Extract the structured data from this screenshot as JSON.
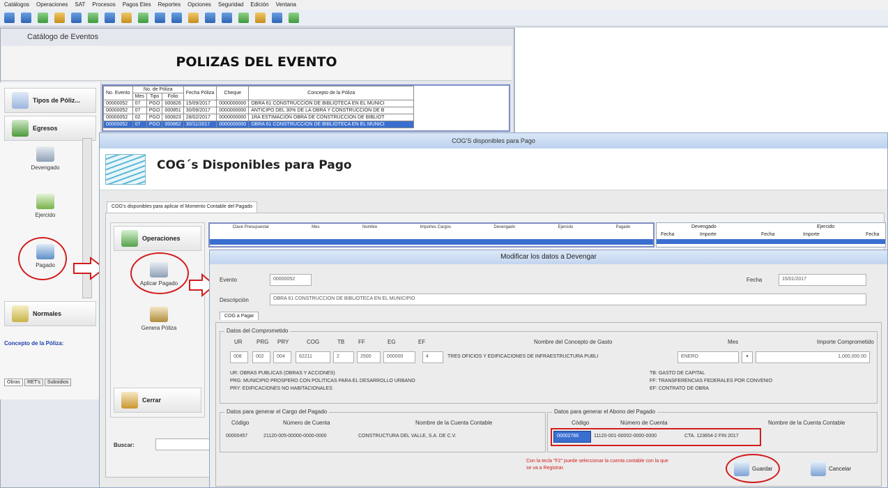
{
  "menu": [
    "Catálogos",
    "Operaciones",
    "SAT",
    "Procesos",
    "Pagos Etes",
    "Reportes",
    "Opciones",
    "Seguridad",
    "Edición",
    "Ventana"
  ],
  "catalog_window_title": "Catálogo de Eventos",
  "polizas_title": "POLIZAS DEL EVENTO",
  "left_nav": {
    "tipos": "Tipos de Póliz...",
    "egresos": "Egresos",
    "devengado": "Devengado",
    "ejercido": "Ejercido",
    "pagado": "Pagado",
    "normales": "Normales",
    "concepto": "Concepto de la Póliza:",
    "tabs": [
      "Obras",
      "RET's",
      "Subsidios"
    ]
  },
  "polizas_table": {
    "headers": [
      "No. Evento",
      "No. de Póliza",
      "Fecha Póliza",
      "Cheque",
      "Concepto de la Póliza"
    ],
    "subheaders": [
      "Mes",
      "Tipo",
      "Folio"
    ],
    "rows": [
      [
        "00000052",
        "07",
        "PGO",
        "000826",
        "15/09/2017",
        "0000000000",
        "OBRA 61 CONSTRUCCION DE BIBLIOTECA EN EL MUNICI"
      ],
      [
        "00000052",
        "07",
        "PGO",
        "000851",
        "30/09/2017",
        "0000000000",
        "ANTICIPO DEL 30% DE LA OBRA Y CONSTRUCCION DE B"
      ],
      [
        "00000052",
        "02",
        "PGO",
        "000823",
        "28/02/2017",
        "0000000000",
        "1RA ESTIMACIÓN OBRA DE CONSTRUCCION DE BIBLIOT"
      ],
      [
        "00000052",
        "07",
        "PGO",
        "000862",
        "30/11/2017",
        "0000000000",
        "OBRA 61 CONSTRUCCION DE BIBLIOTECA EN EL MUNICI"
      ]
    ]
  },
  "cog_window": {
    "title": "COG'S disponibles para Pago",
    "heading": "COG´s Disponibles para Pago",
    "tab": "COG's disponibles para aplicar el Momento Contable del Pagado",
    "operaciones": "Operaciones",
    "aplicar_pagado": "Aplicar Pagado",
    "genera_poliza": "Genera Póliza",
    "cerrar": "Cerrar",
    "buscar": "Buscar:",
    "devengado_hdr": "Devengado",
    "ejercido_hdr": "Ejercido",
    "fecha": "Fecha",
    "importe": "Importe",
    "grid_headers": [
      "Clave Presupuestal",
      "Mes",
      "Nombre",
      "Importes Cargos",
      "Devengado",
      "Ejercido",
      "Pagado"
    ]
  },
  "modify_window": {
    "title": "Modificar los datos a Devengar",
    "evento_label": "Evento",
    "evento_value": "00000052",
    "fecha_label": "Fecha",
    "fecha_value": "15/01/2017",
    "descripcion_label": "Descripción",
    "descripcion_value": "OBRA 61 CONSTRUCCION DE BIBLIOTECA EN EL MUNICIPIO",
    "tab": "COG a Pagar",
    "comprometido_legend": "Datos del Comprometido",
    "col_headers": [
      "UR",
      "PRG",
      "PRY",
      "COG",
      "TB",
      "FF",
      "EG",
      "EF",
      "Nombre del Concepto de Gasto",
      "Mes",
      "Importe Comprometido"
    ],
    "values": [
      "008",
      "002",
      "004",
      "62211",
      "2",
      "2500",
      "000000",
      "4",
      "TRES OFICIOS Y EDIFICACIONES DE INFRAESTRUCTURA PUBLI",
      "ENERO",
      "1,000,000.00"
    ],
    "desc_lines": [
      "UR:  OBRAS PUBLICAS (OBRAS Y ACCIONES)",
      "PRG: MUNICIPIO PROSPERO CON POLITICAS PARA EL DESARROLLO URBANO",
      "PRY: EDIFICACIONES NO HABITACIONALES"
    ],
    "desc_lines_right": [
      "TB:  GASTO DE CAPITAL",
      "FF:  TRANSFERENCIAS FEDERALES POR CONVENIO",
      "EF:  CONTRATO DE OBRA"
    ],
    "cargo_legend": "Datos para generar el Cargo del Pagado",
    "cargo_headers": [
      "Código",
      "Número de Cuenta",
      "Nombre de la Cuenta Contable"
    ],
    "cargo_values": [
      "00000457",
      "21120-005-00000-0000-0000",
      "CONSTRUCTURA DEL VALLE, S.A. DE C.V."
    ],
    "abono_legend": "Datos para generar el Abono del Pagado",
    "abono_headers": [
      "Código",
      "Número de Cuenta",
      "Nombre de la Cuenta Contable"
    ],
    "abono_values": [
      "00002766",
      "11120-001-00002-0000-0000",
      "CTA. 123654-2 FIN 2017"
    ],
    "hint": "Con la tecla \"F2\" puede seleccionar la cuenta contable con la que se va a Registrar.",
    "guardar": "Guardar",
    "cancelar": "Cancelar"
  },
  "colors": {
    "highlight": "#d21c1c",
    "selection": "#3a6fd0"
  }
}
